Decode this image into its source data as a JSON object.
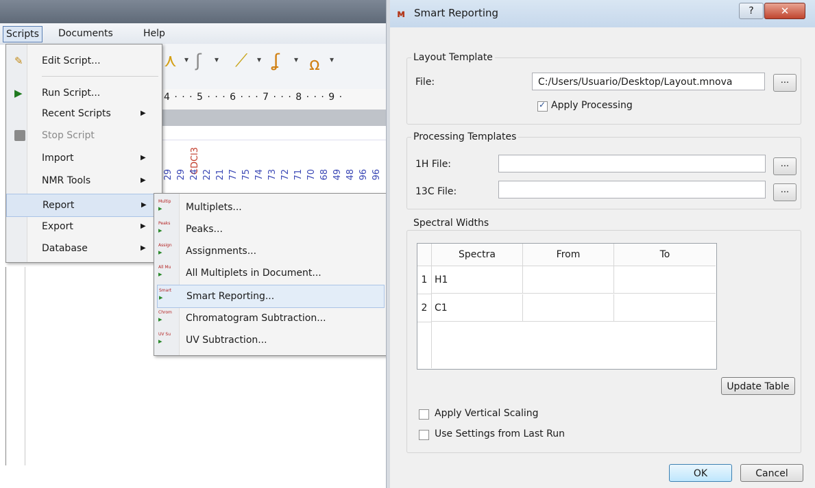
{
  "app": {
    "menubar": [
      "Scripts",
      "Documents",
      "Help"
    ],
    "ruler": "4 · · · 5 · · · 6 · · · 7 · · · 8 · · · 9 ·",
    "solvent_label": "CDCl3",
    "peak_labels": [
      "29",
      "29",
      "24",
      "22",
      "21",
      "77",
      "75",
      "74",
      "73",
      "72",
      "71",
      "70",
      "68",
      "49",
      "48",
      "96",
      "96"
    ]
  },
  "scripts_menu": {
    "items": [
      {
        "label": "Edit Script...",
        "icon": "edit-script-icon",
        "submenu": false,
        "disabled": false
      },
      {
        "label": "Run Script...",
        "icon": "run-script-icon",
        "submenu": false,
        "disabled": false
      },
      {
        "label": "Recent Scripts",
        "icon": "",
        "submenu": true,
        "disabled": false
      },
      {
        "label": "Stop Script",
        "icon": "stop-script-icon",
        "submenu": false,
        "disabled": true
      },
      {
        "label": "Import",
        "icon": "",
        "submenu": true,
        "disabled": false
      },
      {
        "label": "NMR Tools",
        "icon": "",
        "submenu": true,
        "disabled": false
      },
      {
        "label": "Report",
        "icon": "",
        "submenu": true,
        "disabled": false
      },
      {
        "label": "Export",
        "icon": "",
        "submenu": true,
        "disabled": false
      },
      {
        "label": "Database",
        "icon": "",
        "submenu": true,
        "disabled": false
      }
    ]
  },
  "report_menu": {
    "items": [
      {
        "label": "Multiplets...",
        "tag": "Multip"
      },
      {
        "label": "Peaks...",
        "tag": "Peaks"
      },
      {
        "label": "Assignments...",
        "tag": "Assign"
      },
      {
        "label": "All Multiplets in Document...",
        "tag": "All Mu"
      },
      {
        "label": "Smart Reporting...",
        "tag": "Smart"
      },
      {
        "label": "Chromatogram Subtraction...",
        "tag": "Chrom"
      },
      {
        "label": "UV Subtraction...",
        "tag": "UV Su"
      }
    ]
  },
  "dialog": {
    "title": "Smart Reporting",
    "help_label": "?",
    "close_label": "✕",
    "layout_group": {
      "title": "Layout Template",
      "file_label": "File:",
      "file_value": "C:/Users/Usuario/Desktop/Layout.mnova",
      "browse_label": "...",
      "apply_processing_label": "Apply Processing",
      "apply_processing_checked": true
    },
    "processing_group": {
      "title": "Processing Templates",
      "h1_label": "1H File:",
      "h1_value": "",
      "c13_label": "13C File:",
      "c13_value": "",
      "browse_label": "..."
    },
    "spectral_group": {
      "title": "Spectral Widths",
      "columns": [
        "Spectra",
        "From",
        "To"
      ],
      "rows": [
        {
          "num": "1",
          "spectra": "H1",
          "from": "",
          "to": ""
        },
        {
          "num": "2",
          "spectra": "C1",
          "from": "",
          "to": ""
        }
      ],
      "update_label": "Update Table",
      "apply_vertical_label": "Apply Vertical Scaling",
      "apply_vertical_checked": false,
      "use_settings_label": "Use Settings from Last Run",
      "use_settings_checked": false
    },
    "ok_label": "OK",
    "cancel_label": "Cancel"
  }
}
